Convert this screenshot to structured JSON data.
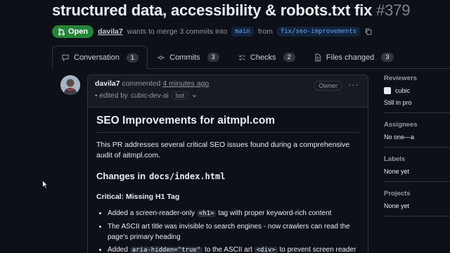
{
  "pr": {
    "title": "structured data, accessibility & robots.txt fix",
    "number": "#379",
    "state": "Open",
    "author": "davila7",
    "merge_text": "wants to merge 3 commits into",
    "base_branch": "main",
    "from_text": "from",
    "head_branch": "fix/seo-improvements"
  },
  "tabs": [
    {
      "label": "Conversation",
      "count": "1",
      "icon": "comment-icon"
    },
    {
      "label": "Commits",
      "count": "3",
      "icon": "commit-icon"
    },
    {
      "label": "Checks",
      "count": "2",
      "icon": "checks-icon"
    },
    {
      "label": "Files changed",
      "count": "3",
      "icon": "file-diff-icon"
    }
  ],
  "comment": {
    "author": "davila7",
    "action": "commented",
    "time": "4 minutes ago",
    "edited_text": "• edited by",
    "editor": "cubic-dev-ai",
    "bot_badge": "bot",
    "role_badge": "Owner",
    "heading": "SEO Improvements for aitmpl.com",
    "intro": "This PR addresses several critical SEO issues found during a comprehensive audit of aitmpl.com.",
    "changes_prefix": "Changes in",
    "changes_file": "docs/index.html",
    "subheading": "Critical: Missing H1 Tag",
    "bullets": [
      {
        "a": "Added a screen-reader-only",
        "code": "<h1>",
        "b": "tag with proper keyword-rich content"
      },
      {
        "a": "The ASCII art title was invisible to search engines - now crawlers can read the page's primary heading",
        "code": "",
        "b": ""
      },
      {
        "a": "Added",
        "code": "aria-hidden=\"true\"",
        "b": "to the ASCII art",
        "code2": "<div>",
        "c": "to prevent screen reader"
      }
    ]
  },
  "sidebar": {
    "reviewers_label": "Reviewers",
    "reviewer": "cubic",
    "reviewer_status": "Still in pro",
    "assignees_label": "Assignees",
    "assignees_value": "No one—a",
    "labels_label": "Labels",
    "labels_value": "None yet",
    "projects_label": "Projects",
    "projects_value": "None yet"
  },
  "colors": {
    "background": "#0d1117",
    "open_badge": "#238636",
    "link": "#58a6ff"
  }
}
